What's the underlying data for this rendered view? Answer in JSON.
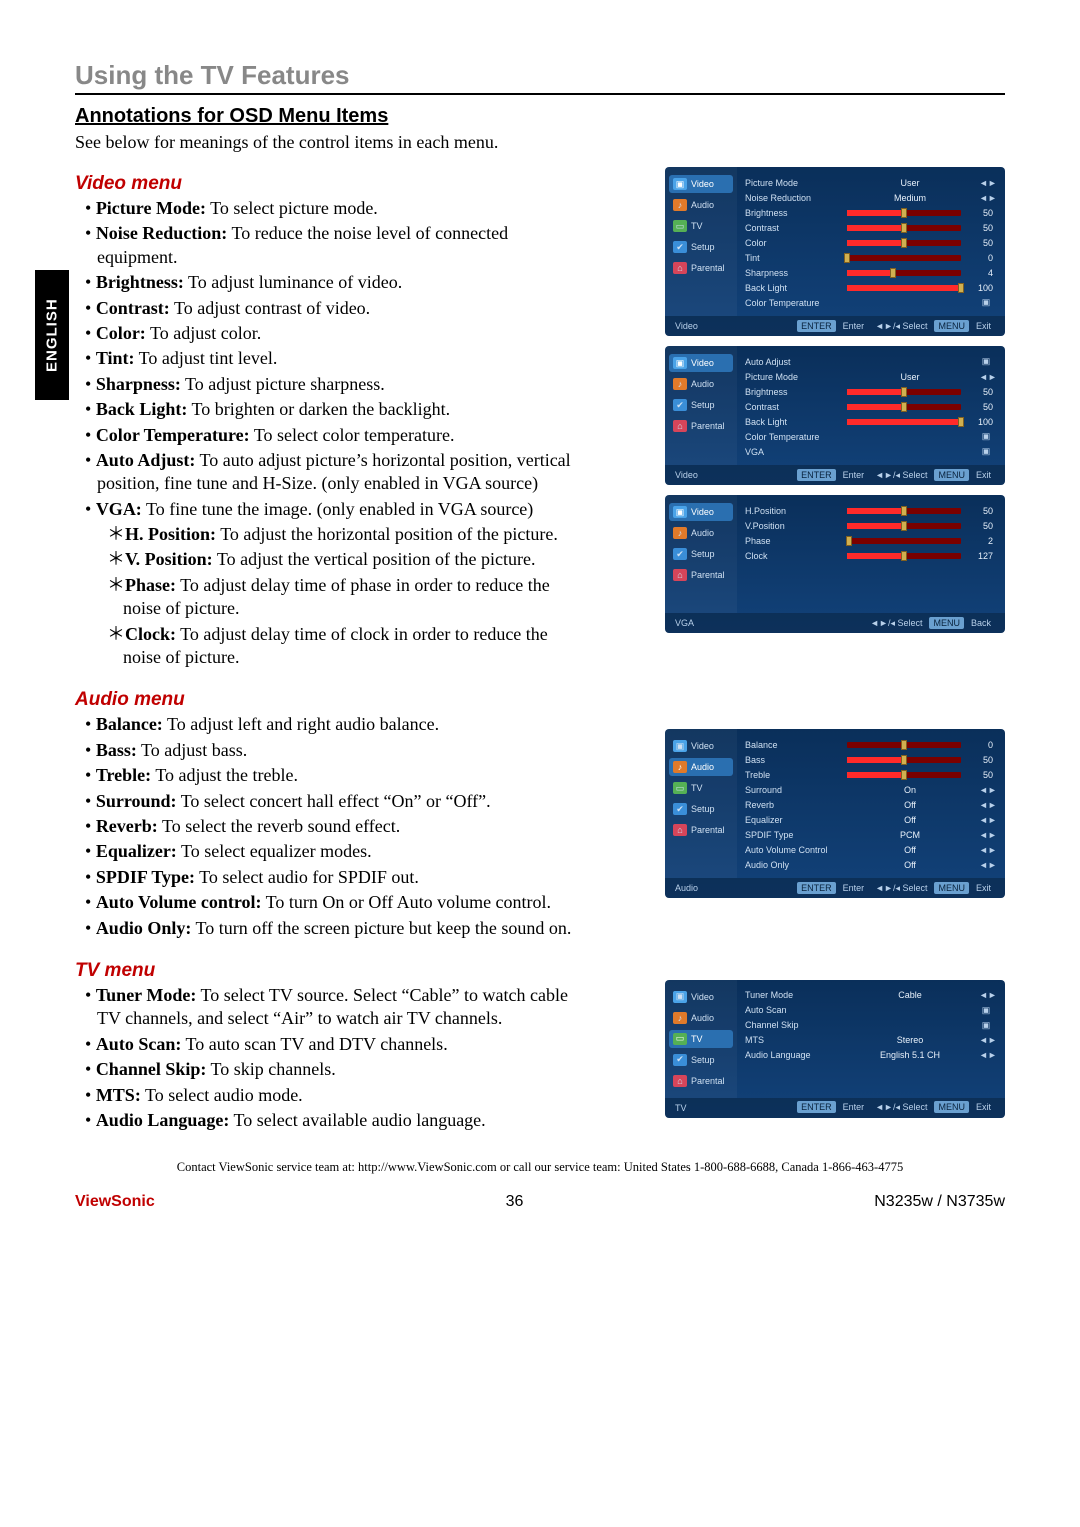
{
  "lang_tab": "ENGLISH",
  "section_title": "Using the TV Features",
  "sub_title": "Annotations for OSD Menu Items",
  "intro": "See below for meanings of the control items in each menu.",
  "video_menu": {
    "heading": "Video menu",
    "items": [
      {
        "label": "Picture Mode:",
        "desc": " To select picture mode."
      },
      {
        "label": "Noise Reduction:",
        "desc": " To reduce the noise level of connected equipment."
      },
      {
        "label": "Brightness:",
        "desc": " To adjust luminance of video."
      },
      {
        "label": "Contrast:",
        "desc": " To adjust contrast of video."
      },
      {
        "label": "Color:",
        "desc": " To adjust color."
      },
      {
        "label": "Tint:",
        "desc": " To adjust tint level."
      },
      {
        "label": "Sharpness:",
        "desc": " To adjust picture sharpness."
      },
      {
        "label": "Back Light:",
        "desc": " To brighten or darken the backlight."
      },
      {
        "label": "Color Temperature:",
        "desc": " To select color temperature."
      },
      {
        "label": "Auto Adjust:",
        "desc": " To auto adjust picture’s horizontal position, vertical position, fine tune and H-Size. (only enabled in VGA source)"
      },
      {
        "label": "VGA:",
        "desc": " To fine tune the image. (only enabled in VGA source)"
      }
    ],
    "vga_sub": [
      {
        "label": "H. Position:",
        "desc": " To adjust the horizontal position of the picture."
      },
      {
        "label": "V. Position:",
        "desc": " To adjust the vertical position of the picture."
      },
      {
        "label": "Phase:",
        "desc": " To adjust delay time of phase in order to reduce the noise of picture."
      },
      {
        "label": "Clock:",
        "desc": " To adjust delay time of clock in order to reduce the noise of picture."
      }
    ]
  },
  "audio_menu": {
    "heading": "Audio menu",
    "items": [
      {
        "label": "Balance:",
        "desc": " To adjust left and right audio balance."
      },
      {
        "label": "Bass:",
        "desc": " To adjust bass."
      },
      {
        "label": "Treble:",
        "desc": " To adjust the treble."
      },
      {
        "label": "Surround:",
        "desc": " To select concert hall effect “On” or “Off”."
      },
      {
        "label": "Reverb:",
        "desc": " To select the reverb sound effect."
      },
      {
        "label": "Equalizer:",
        "desc": " To select equalizer modes."
      },
      {
        "label": "SPDIF Type:",
        "desc": " To select audio for SPDIF out."
      },
      {
        "label": "Auto Volume control:",
        "desc": " To turn On or Off Auto volume control."
      },
      {
        "label": "Audio Only:",
        "desc": " To turn off the screen picture but keep the sound on."
      }
    ]
  },
  "tv_menu": {
    "heading": "TV menu",
    "items": [
      {
        "label": "Tuner Mode:",
        "desc": " To select TV source. Select “Cable” to watch cable TV channels, and select “Air” to watch air TV channels."
      },
      {
        "label": "Auto Scan:",
        "desc": " To auto scan TV and DTV channels."
      },
      {
        "label": "Channel Skip:",
        "desc": " To skip channels."
      },
      {
        "label": "MTS:",
        "desc": " To select audio mode."
      },
      {
        "label": "Audio Language:",
        "desc": " To select available audio language."
      }
    ]
  },
  "osd": {
    "tabs": {
      "video": "Video",
      "audio": "Audio",
      "tv": "TV",
      "setup": "Setup",
      "parental": "Parental"
    },
    "hint_enter": "ENTER",
    "hint_enter_v": "Enter",
    "hint_sel": "◄/► Select",
    "hint_sel2": "◄►/◂ Select",
    "hint_menu": "MENU",
    "hint_exit": "Exit",
    "hint_back": "Back",
    "video1": {
      "name": "Video",
      "rows": [
        {
          "label": "Picture Mode",
          "type": "text",
          "value": "User"
        },
        {
          "label": "Noise Reduction",
          "type": "text",
          "value": "Medium"
        },
        {
          "label": "Brightness",
          "type": "slider",
          "value": 50,
          "max": 100
        },
        {
          "label": "Contrast",
          "type": "slider",
          "value": 50,
          "max": 100
        },
        {
          "label": "Color",
          "type": "slider",
          "value": 50,
          "max": 100
        },
        {
          "label": "Tint",
          "type": "slider",
          "value": 0,
          "max": 100
        },
        {
          "label": "Sharpness",
          "type": "slider",
          "value": 4,
          "max": 10
        },
        {
          "label": "Back Light",
          "type": "slider",
          "value": 100,
          "max": 100
        },
        {
          "label": "Color Temperature",
          "type": "enter",
          "value": ""
        }
      ]
    },
    "video2": {
      "name": "Video",
      "rows": [
        {
          "label": "Auto Adjust",
          "type": "enter",
          "value": ""
        },
        {
          "label": "Picture Mode",
          "type": "text",
          "value": "User"
        },
        {
          "label": "Brightness",
          "type": "slider",
          "value": 50,
          "max": 100
        },
        {
          "label": "Contrast",
          "type": "slider",
          "value": 50,
          "max": 100
        },
        {
          "label": "Back Light",
          "type": "slider",
          "value": 100,
          "max": 100
        },
        {
          "label": "Color Temperature",
          "type": "enter",
          "value": ""
        },
        {
          "label": "VGA",
          "type": "enter",
          "value": ""
        }
      ]
    },
    "vga": {
      "name": "VGA",
      "rows": [
        {
          "label": "H.Position",
          "type": "slider",
          "value": 50,
          "max": 100
        },
        {
          "label": "V.Position",
          "type": "slider",
          "value": 50,
          "max": 100
        },
        {
          "label": "Phase",
          "type": "slider",
          "value": 2,
          "max": 100
        },
        {
          "label": "Clock",
          "type": "slider",
          "value": 127,
          "max": 255
        }
      ]
    },
    "audio": {
      "name": "Audio",
      "rows": [
        {
          "label": "Balance",
          "type": "slider",
          "value": 0,
          "max": 100,
          "center": true
        },
        {
          "label": "Bass",
          "type": "slider",
          "value": 50,
          "max": 100
        },
        {
          "label": "Treble",
          "type": "slider",
          "value": 50,
          "max": 100
        },
        {
          "label": "Surround",
          "type": "text",
          "value": "On"
        },
        {
          "label": "Reverb",
          "type": "text",
          "value": "Off"
        },
        {
          "label": "Equalizer",
          "type": "text",
          "value": "Off"
        },
        {
          "label": "SPDIF Type",
          "type": "text",
          "value": "PCM"
        },
        {
          "label": "Auto Volume Control",
          "type": "text",
          "value": "Off"
        },
        {
          "label": "Audio Only",
          "type": "text",
          "value": "Off"
        }
      ]
    },
    "tv": {
      "name": "TV",
      "rows": [
        {
          "label": "Tuner Mode",
          "type": "text",
          "value": "Cable"
        },
        {
          "label": "Auto Scan",
          "type": "enter",
          "value": ""
        },
        {
          "label": "Channel Skip",
          "type": "enter",
          "value": ""
        },
        {
          "label": "MTS",
          "type": "text",
          "value": "Stereo"
        },
        {
          "label": "Audio Language",
          "type": "text",
          "value": "English 5.1 CH"
        }
      ]
    }
  },
  "footer_contact": "Contact ViewSonic service team at: http://www.ViewSonic.com or call our service team: United States 1-800-688-6688, Canada 1-866-463-4775",
  "footer": {
    "brand": "ViewSonic",
    "page": "36",
    "model": "N3235w / N3735w"
  }
}
